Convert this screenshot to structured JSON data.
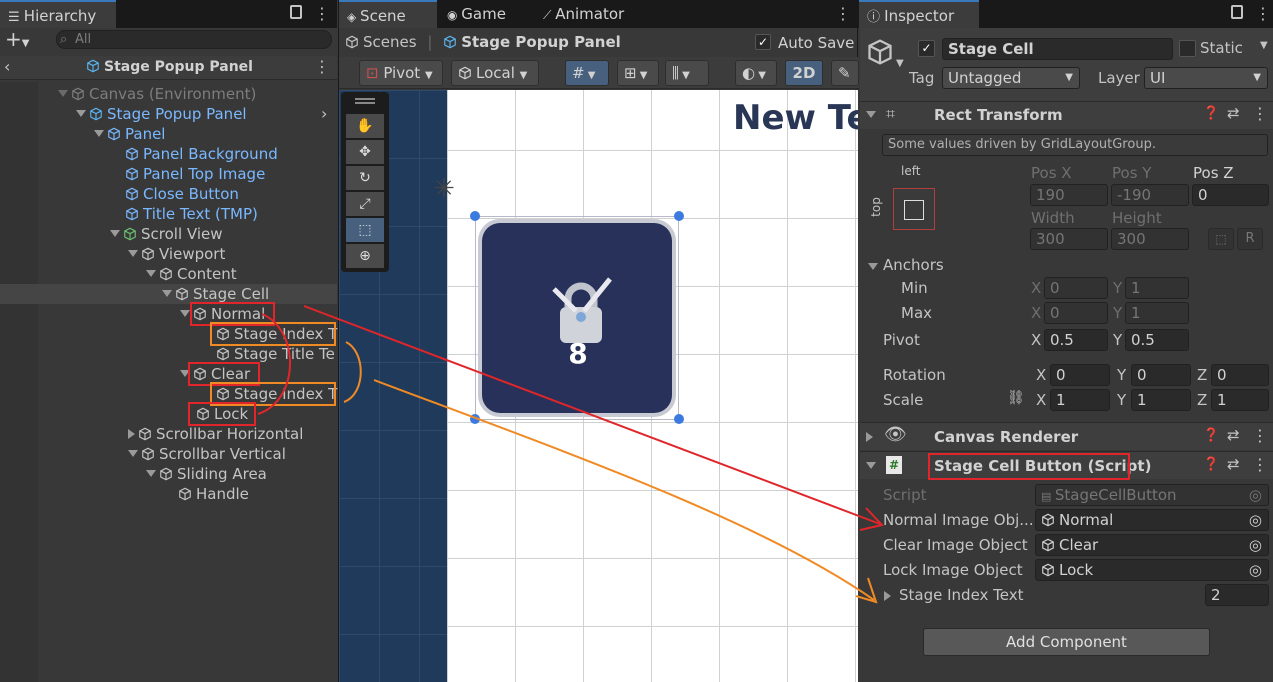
{
  "hierarchy": {
    "tab": "Hierarchy",
    "search_placeholder": "All",
    "root_title": "Stage Popup Panel",
    "items": [
      {
        "label": "Canvas (Environment)"
      },
      {
        "label": "Stage Popup Panel"
      },
      {
        "label": "Panel"
      },
      {
        "label": "Panel Background"
      },
      {
        "label": "Panel Top Image"
      },
      {
        "label": "Close Button"
      },
      {
        "label": "Title Text (TMP)"
      },
      {
        "label": "Scroll View"
      },
      {
        "label": "Viewport"
      },
      {
        "label": "Content"
      },
      {
        "label": "Stage Cell"
      },
      {
        "label": "Normal"
      },
      {
        "label": "Stage Index T"
      },
      {
        "label": "Stage Title Te"
      },
      {
        "label": "Clear"
      },
      {
        "label": "Stage Index T"
      },
      {
        "label": "Lock"
      },
      {
        "label": "Scrollbar Horizontal"
      },
      {
        "label": "Scrollbar Vertical"
      },
      {
        "label": "Sliding Area"
      },
      {
        "label": "Handle"
      }
    ]
  },
  "scene": {
    "tabs": [
      "Scene",
      "Game",
      "Animator"
    ],
    "breadcrumb_root": "Scenes",
    "breadcrumb_current": "Stage Popup Panel",
    "auto_save_label": "Auto Save",
    "pivot_label": "Pivot",
    "local_label": "Local",
    "mode_2d": "2D",
    "title_text": "New Te",
    "cell_number": "8"
  },
  "inspector": {
    "tab": "Inspector",
    "object_name": "Stage Cell",
    "static_label": "Static",
    "tag_label": "Tag",
    "tag_value": "Untagged",
    "layer_label": "Layer",
    "layer_value": "UI",
    "rect_transform": {
      "title": "Rect Transform",
      "info": "Some values driven by GridLayoutGroup.",
      "anchor_h": "left",
      "anchor_v": "top",
      "pos_x_label": "Pos X",
      "pos_x": "190",
      "pos_y_label": "Pos Y",
      "pos_y": "-190",
      "pos_z_label": "Pos Z",
      "pos_z": "0",
      "width_label": "Width",
      "width": "300",
      "height_label": "Height",
      "height": "300",
      "r_btn": "R",
      "anchors_label": "Anchors",
      "min_label": "Min",
      "min_x": "0",
      "min_y": "1",
      "max_label": "Max",
      "max_x": "0",
      "max_y": "1",
      "pivot_label": "Pivot",
      "pivot_x": "0.5",
      "pivot_y": "0.5",
      "rotation_label": "Rotation",
      "rot_x": "0",
      "rot_y": "0",
      "rot_z": "0",
      "scale_label": "Scale",
      "scale_x": "1",
      "scale_y": "1",
      "scale_z": "1",
      "x": "X",
      "y": "Y",
      "z": "Z"
    },
    "canvas_renderer": "Canvas Renderer",
    "script_component": {
      "title": "Stage Cell Button (Script)",
      "script_label": "Script",
      "script_value": "StageCellButton",
      "normal_label": "Normal Image Obj...",
      "normal_value": "Normal",
      "clear_label": "Clear Image Object",
      "clear_value": "Clear",
      "lock_label": "Lock Image Object",
      "lock_value": "Lock",
      "index_label": "Stage Index Text",
      "index_value": "2"
    },
    "add_component": "Add Component"
  },
  "colors": {
    "accent": "#3a79bb",
    "red_annotation": "#e0262a",
    "orange_annotation": "#f08a24",
    "cell_bg": "#27315a"
  }
}
